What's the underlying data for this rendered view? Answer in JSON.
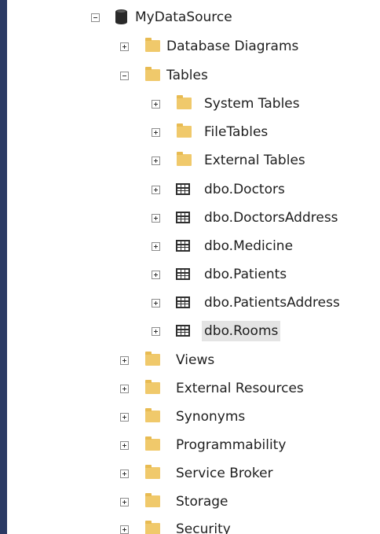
{
  "tree": {
    "root": {
      "label": "MyDataSource",
      "expanded": true,
      "icon": "database-icon"
    },
    "children": [
      {
        "label": "Database Diagrams",
        "icon": "folder-icon",
        "expanded": false
      },
      {
        "label": "Tables",
        "icon": "folder-icon",
        "expanded": true,
        "children": [
          {
            "label": "System Tables",
            "icon": "folder-icon",
            "expanded": false
          },
          {
            "label": "FileTables",
            "icon": "folder-icon",
            "expanded": false
          },
          {
            "label": "External Tables",
            "icon": "folder-icon",
            "expanded": false
          },
          {
            "label": "dbo.Doctors",
            "icon": "table-icon",
            "expanded": false
          },
          {
            "label": "dbo.DoctorsAddress",
            "icon": "table-icon",
            "expanded": false
          },
          {
            "label": "dbo.Medicine",
            "icon": "table-icon",
            "expanded": false
          },
          {
            "label": "dbo.Patients",
            "icon": "table-icon",
            "expanded": false
          },
          {
            "label": "dbo.PatientsAddress",
            "icon": "table-icon",
            "expanded": false
          },
          {
            "label": "dbo.Rooms",
            "icon": "table-icon",
            "expanded": false,
            "selected": true
          }
        ]
      },
      {
        "label": "Views",
        "icon": "folder-icon",
        "expanded": false
      },
      {
        "label": "External Resources",
        "icon": "folder-icon",
        "expanded": false
      },
      {
        "label": "Synonyms",
        "icon": "folder-icon",
        "expanded": false
      },
      {
        "label": "Programmability",
        "icon": "folder-icon",
        "expanded": false
      },
      {
        "label": "Service Broker",
        "icon": "folder-icon",
        "expanded": false
      },
      {
        "label": "Storage",
        "icon": "folder-icon",
        "expanded": false
      },
      {
        "label": "Security",
        "icon": "folder-icon",
        "expanded": false
      }
    ]
  },
  "colors": {
    "left_bar": "#2b3a64",
    "folder": "#f0c96b",
    "selection": "#e4e4e4"
  }
}
